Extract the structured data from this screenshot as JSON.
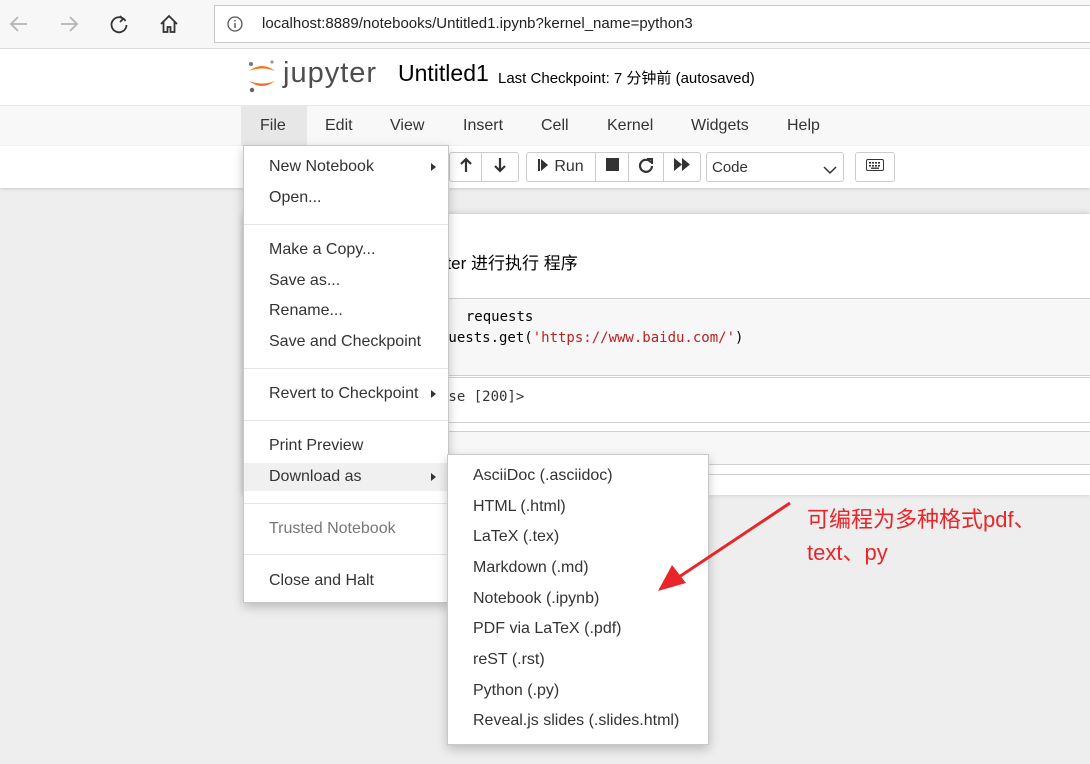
{
  "browser": {
    "url": "localhost:8889/notebooks/Untitled1.ipynb?kernel_name=python3"
  },
  "header": {
    "logo_text": "jupyter",
    "notebook_title": "Untitled1",
    "checkpoint_text": "Last Checkpoint: 7 分钟前   (autosaved)"
  },
  "menubar": {
    "items": [
      "File",
      "Edit",
      "View",
      "Insert",
      "Cell",
      "Kernel",
      "Widgets",
      "Help"
    ]
  },
  "toolbar": {
    "run_label": "Run",
    "cell_type": "Code"
  },
  "notebook": {
    "markdown_fragment": "nter 进行执行 程序",
    "code_line1": " requests",
    "code_line2_prefix": "quests.get(",
    "code_line2_string": "'https://www.baidu.com/'",
    "code_line2_suffix": ")",
    "output_fragment": "nse [200]>"
  },
  "file_menu": {
    "new_notebook": "New Notebook",
    "open": "Open...",
    "make_copy": "Make a Copy...",
    "save_as": "Save as...",
    "rename": "Rename...",
    "save_checkpoint": "Save and Checkpoint",
    "revert": "Revert to Checkpoint",
    "print_preview": "Print Preview",
    "download_as": "Download as",
    "trusted": "Trusted Notebook",
    "close_halt": "Close and Halt"
  },
  "download_menu": {
    "items": [
      "AsciiDoc (.asciidoc)",
      "HTML (.html)",
      "LaTeX (.tex)",
      "Markdown (.md)",
      "Notebook (.ipynb)",
      "PDF via LaTeX (.pdf)",
      "reST (.rst)",
      "Python (.py)",
      "Reveal.js slides (.slides.html)"
    ]
  },
  "annotation": {
    "line1": "可编程为多种格式pdf、",
    "line2": "text、py",
    "color": "#e8262a"
  },
  "colors": {
    "jupyter_orange": "#f37626",
    "string_red": "#ba2121"
  }
}
